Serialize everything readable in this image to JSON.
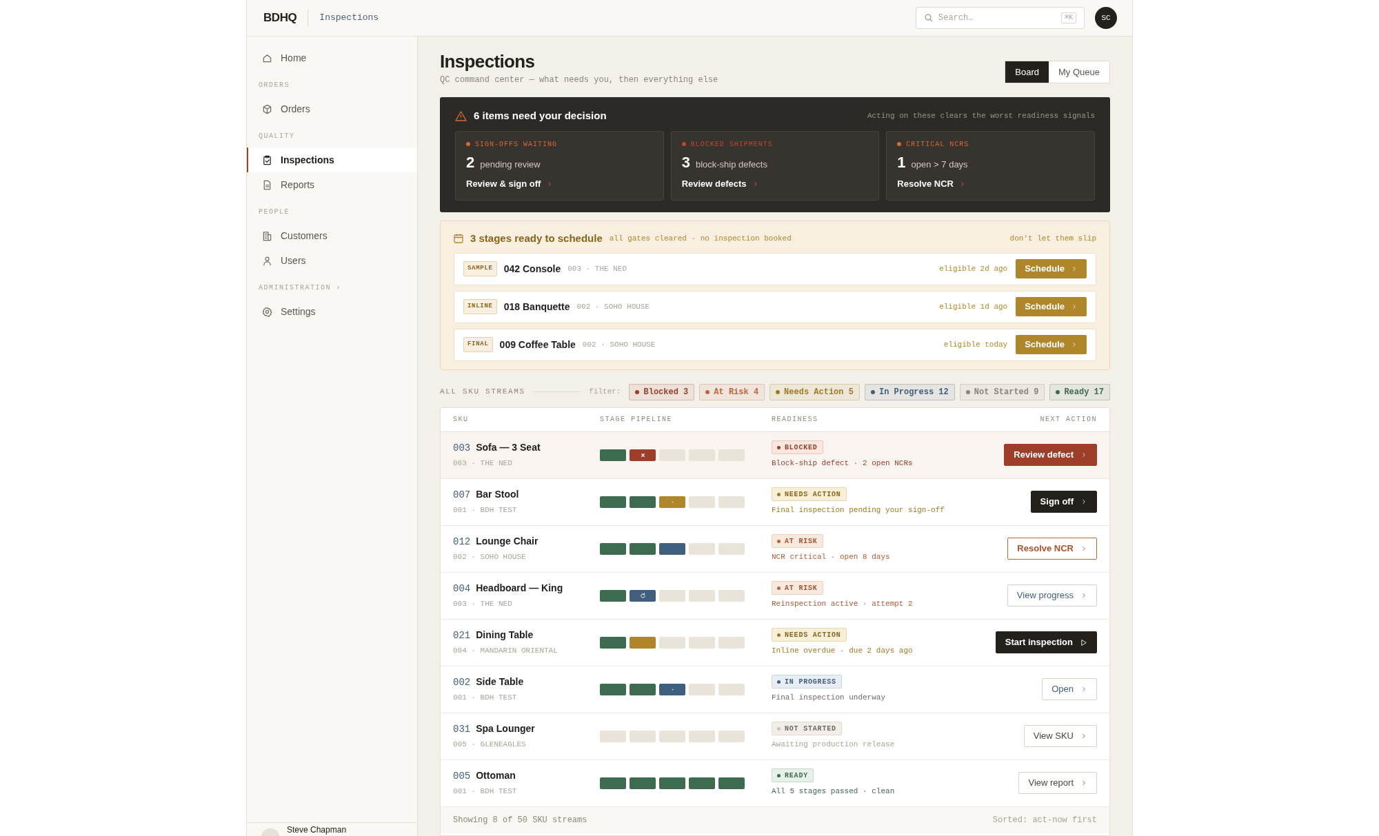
{
  "header": {
    "logo": "BDHQ",
    "breadcrumb": "Inspections",
    "search": {
      "placeholder": "Search…",
      "shortcut": "⌘K"
    },
    "avatar": "SC"
  },
  "sidebar": {
    "sections": [
      {
        "items": [
          {
            "label": "Home",
            "selected": false
          }
        ]
      },
      {
        "label": "ORDERS",
        "items": [
          {
            "label": "Orders",
            "selected": false
          }
        ]
      },
      {
        "label": "QUALITY",
        "items": [
          {
            "label": "Inspections",
            "selected": true
          },
          {
            "label": "Reports",
            "selected": false
          }
        ]
      },
      {
        "label": "PEOPLE",
        "items": [
          {
            "label": "Customers",
            "selected": false
          },
          {
            "label": "Users",
            "selected": false
          }
        ]
      },
      {
        "label": "ADMINISTRATION ›",
        "items": [
          {
            "label": "Settings",
            "selected": false
          }
        ]
      }
    ],
    "user": "Steve Chapman"
  },
  "page": {
    "title": "Inspections",
    "subtitle": "QC command center — what needs you, then everything else",
    "views": [
      {
        "label": "Board",
        "selected": true
      },
      {
        "label": "My Queue",
        "selected": false
      }
    ]
  },
  "decision": {
    "title": "6 items need your decision",
    "note": "Acting on these clears the worst readiness signals",
    "cards": [
      {
        "label": "SIGN-OFFS WAITING",
        "count": "2",
        "text": "pending review",
        "action": "Review & sign off",
        "color": "#d4693a"
      },
      {
        "label": "BLOCKED SHIPMENTS",
        "count": "3",
        "text": "block-ship defects",
        "action": "Review defects",
        "color": "#c0452f"
      },
      {
        "label": "CRITICAL NCRS",
        "count": "1",
        "text": "open > 7 days",
        "action": "Resolve NCR",
        "color": "#d4693a"
      }
    ]
  },
  "schedule": {
    "title": "3 stages ready to schedule",
    "subtitle": "all gates cleared · no inspection booked",
    "note": "don't let them slip",
    "items": [
      {
        "stage": "SAMPLE",
        "name": "042 Console",
        "meta": "003 · THE NED",
        "eligible": "eligible 2d ago",
        "action": "Schedule"
      },
      {
        "stage": "INLINE",
        "name": "018 Banquette",
        "meta": "002 · SOHO HOUSE",
        "eligible": "eligible 1d ago",
        "action": "Schedule"
      },
      {
        "stage": "FINAL",
        "name": "009 Coffee Table",
        "meta": "002 · SOHO HOUSE",
        "eligible": "eligible today",
        "action": "Schedule"
      }
    ]
  },
  "streams": {
    "label": "ALL SKU STREAMS",
    "filter_label": "filter:",
    "filters": [
      {
        "label": "Blocked 3",
        "color": "#9c3e2a"
      },
      {
        "label": "At Risk 4",
        "color": "#c0643a"
      },
      {
        "label": "Needs Action 5",
        "color": "#a07a22"
      },
      {
        "label": "In Progress 12",
        "color": "#3f5f7c"
      },
      {
        "label": "Not Started 9",
        "color": "#8a857c"
      },
      {
        "label": "Ready 17",
        "color": "#3d6b4f"
      }
    ]
  },
  "table": {
    "columns": [
      "SKU",
      "STAGE PIPELINE",
      "READINESS",
      "NEXT ACTION"
    ],
    "rows": [
      {
        "code": "003",
        "name": "Sofa — 3 Seat",
        "meta": "003 · THE NED",
        "stages": [
          {
            "kind": "done"
          },
          {
            "kind": "blocked"
          },
          {
            "kind": "todo"
          },
          {
            "kind": "todo"
          },
          {
            "kind": "todo"
          }
        ],
        "kind": "blocked",
        "status": "BLOCKED",
        "detail": "Block-ship defect · 2 open NCRs",
        "action": {
          "kind": "danger",
          "label": "Review defect"
        }
      },
      {
        "code": "007",
        "name": "Bar Stool",
        "meta": "001 · BDH TEST",
        "stages": [
          {
            "kind": "done"
          },
          {
            "kind": "done"
          },
          {
            "kind": "pending"
          },
          {
            "kind": "todo"
          },
          {
            "kind": "todo"
          }
        ],
        "kind": "needs",
        "status": "NEEDS ACTION",
        "detail": "Final inspection pending your sign-off",
        "action": {
          "kind": "dark",
          "label": "Sign off"
        }
      },
      {
        "code": "012",
        "name": "Lounge Chair",
        "meta": "002 · SOHO HOUSE",
        "stages": [
          {
            "kind": "done"
          },
          {
            "kind": "done"
          },
          {
            "kind": "active"
          },
          {
            "kind": "todo"
          },
          {
            "kind": "todo"
          }
        ],
        "kind": "risk",
        "status": "AT RISK",
        "detail": "NCR critical · open 8 days",
        "action": {
          "kind": "outline-risk",
          "label": "Resolve NCR"
        }
      },
      {
        "code": "004",
        "name": "Headboard — King",
        "meta": "003 · THE NED",
        "stages": [
          {
            "kind": "done"
          },
          {
            "kind": "reinspect"
          },
          {
            "kind": "todo"
          },
          {
            "kind": "todo"
          },
          {
            "kind": "todo"
          }
        ],
        "kind": "risk",
        "status": "AT RISK",
        "detail": "Reinspection active · attempt 2",
        "action": {
          "kind": "outline-ink",
          "label": "View progress"
        }
      },
      {
        "code": "021",
        "name": "Dining Table",
        "meta": "004 · MANDARIN ORIENTAL",
        "stages": [
          {
            "kind": "done"
          },
          {
            "kind": "due"
          },
          {
            "kind": "todo"
          },
          {
            "kind": "todo"
          },
          {
            "kind": "todo"
          }
        ],
        "kind": "needs",
        "status": "NEEDS ACTION",
        "detail": "Inline overdue · due 2 days ago",
        "action": {
          "kind": "start",
          "label": "Start inspection"
        }
      },
      {
        "code": "002",
        "name": "Side Table",
        "meta": "001 · BDH TEST",
        "stages": [
          {
            "kind": "done"
          },
          {
            "kind": "done"
          },
          {
            "kind": "running"
          },
          {
            "kind": "todo"
          },
          {
            "kind": "todo"
          }
        ],
        "kind": "progress",
        "status": "IN PROGRESS",
        "detail": "Final inspection underway",
        "action": {
          "kind": "outline-blue",
          "label": "Open"
        }
      },
      {
        "code": "031",
        "name": "Spa Lounger",
        "meta": "005 · GLENEAGLES",
        "stages": [
          {
            "kind": "todo"
          },
          {
            "kind": "todo"
          },
          {
            "kind": "todo"
          },
          {
            "kind": "todo"
          },
          {
            "kind": "todo"
          }
        ],
        "kind": "idle",
        "status": "NOT STARTED",
        "detail": "Awaiting production release",
        "action": {
          "kind": "outline",
          "label": "View SKU"
        }
      },
      {
        "code": "005",
        "name": "Ottoman",
        "meta": "001 · BDH TEST",
        "stages": [
          {
            "kind": "done"
          },
          {
            "kind": "done"
          },
          {
            "kind": "done"
          },
          {
            "kind": "done"
          },
          {
            "kind": "done"
          }
        ],
        "kind": "ready",
        "status": "READY",
        "detail": "All 5 stages passed · clean",
        "action": {
          "kind": "outline",
          "label": "View report"
        }
      }
    ],
    "footer": {
      "count": "Showing 8 of 50 SKU streams",
      "sort": "Sorted: act-now first"
    }
  }
}
